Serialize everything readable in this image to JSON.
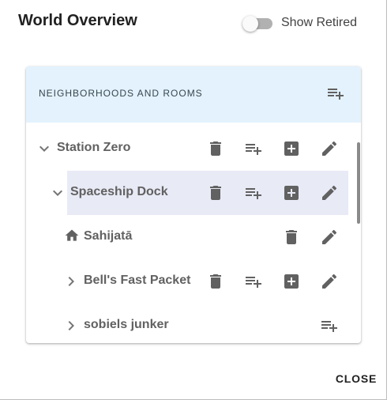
{
  "dialog": {
    "title": "World Overview",
    "toggle": {
      "label": "Show Retired",
      "checked": false
    },
    "close_label": "CLOSE"
  },
  "card": {
    "header": "NEIGHBORHOODS AND ROOMS",
    "header_icon": "playlist-add-icon"
  },
  "tree": {
    "rows": [
      {
        "label": "Station Zero",
        "expander": "chevron-down-icon",
        "actions": [
          "delete-icon",
          "playlist-add-icon",
          "add-box-icon",
          "edit-icon"
        ]
      },
      {
        "label": "Spaceship Dock",
        "expander": "chevron-down-icon",
        "selected": true,
        "actions": [
          "delete-icon",
          "playlist-add-icon",
          "add-box-icon",
          "edit-icon"
        ]
      },
      {
        "label": "Sahijatā",
        "expander": "home-icon",
        "actions": [
          "delete-icon",
          "edit-icon"
        ]
      },
      {
        "label": "Bell's Fast Packet",
        "expander": "chevron-right-icon",
        "actions": [
          "delete-icon",
          "playlist-add-icon",
          "add-box-icon",
          "edit-icon"
        ]
      },
      {
        "label": "sobiels junker",
        "expander": "chevron-right-icon",
        "actions": [
          "playlist-add-icon"
        ]
      }
    ]
  },
  "colors": {
    "header_bg": "#e3f2fd",
    "selected_bg": "#e8eaf6",
    "icon": "#616161"
  }
}
